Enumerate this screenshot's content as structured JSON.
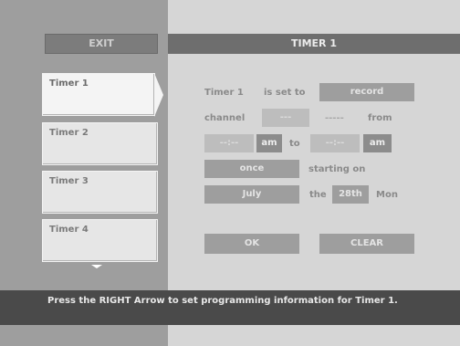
{
  "header": {
    "exit_label": "EXIT",
    "title": "TIMER 1"
  },
  "sidebar": {
    "items": [
      {
        "label": "Timer 1"
      },
      {
        "label": "Timer 2"
      },
      {
        "label": "Timer 3"
      },
      {
        "label": "Timer 4"
      }
    ]
  },
  "form": {
    "timer_name": "Timer 1",
    "is_set_to_label": "is set to",
    "mode_value": "record",
    "channel_label": "channel",
    "channel_value": "---",
    "channel_name_value": "-----",
    "from_label": "from",
    "start_time": "--:--",
    "start_ampm": "am",
    "to_label": "to",
    "end_time": "--:--",
    "end_ampm": "am",
    "frequency_value": "once",
    "starting_on_label": "starting on",
    "month_value": "July",
    "the_label": "the",
    "day_value": "28th",
    "weekday": "Mon"
  },
  "buttons": {
    "ok_label": "OK",
    "clear_label": "CLEAR"
  },
  "status": {
    "message": "Press the RIGHT Arrow to set programming information for Timer 1."
  }
}
